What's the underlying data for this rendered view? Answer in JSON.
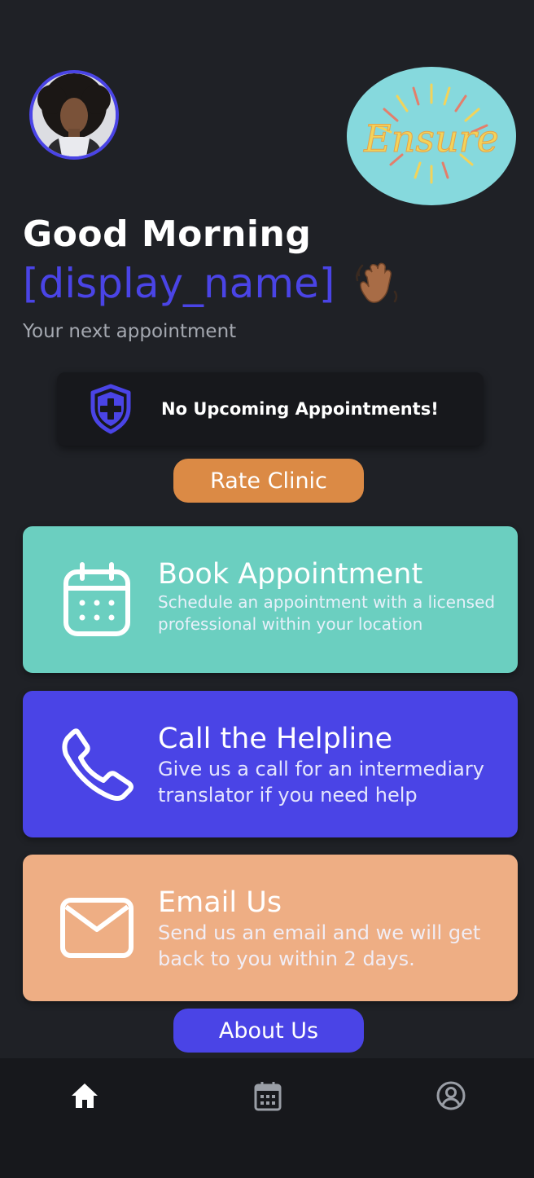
{
  "header": {
    "avatar_icon": "user-photo",
    "logo_text": "Ensure",
    "greeting": "Good Morning",
    "display_name": "[display_name]",
    "wave_icon": "waving-hand-icon",
    "next_appointment_label": "Your next appointment"
  },
  "appointment": {
    "icon": "shield-plus-icon",
    "status_text": "No Upcoming Appointments!"
  },
  "buttons": {
    "rate_clinic": "Rate Clinic",
    "about_us": "About Us"
  },
  "cards": [
    {
      "icon": "calendar-icon",
      "title": "Book Appointment",
      "description": "Schedule an appointment with a licensed professional within your location",
      "color": "#6bcfc0"
    },
    {
      "icon": "phone-icon",
      "title": "Call the Helpline",
      "description": "Give us a call for an intermediary translator if you need help",
      "color": "#4a44e6"
    },
    {
      "icon": "mail-icon",
      "title": "Email Us",
      "description": "Send us an email and we will get back to you within 2 days.",
      "color": "#eeae84"
    }
  ],
  "tabbar": {
    "tabs": [
      {
        "icon": "home-icon",
        "active": true
      },
      {
        "icon": "calendar-icon",
        "active": false
      },
      {
        "icon": "profile-icon",
        "active": false
      }
    ]
  },
  "colors": {
    "background": "#1f2126",
    "accent": "#4a44e6",
    "rate_button": "#db8a45",
    "tabbar": "#17181c"
  }
}
